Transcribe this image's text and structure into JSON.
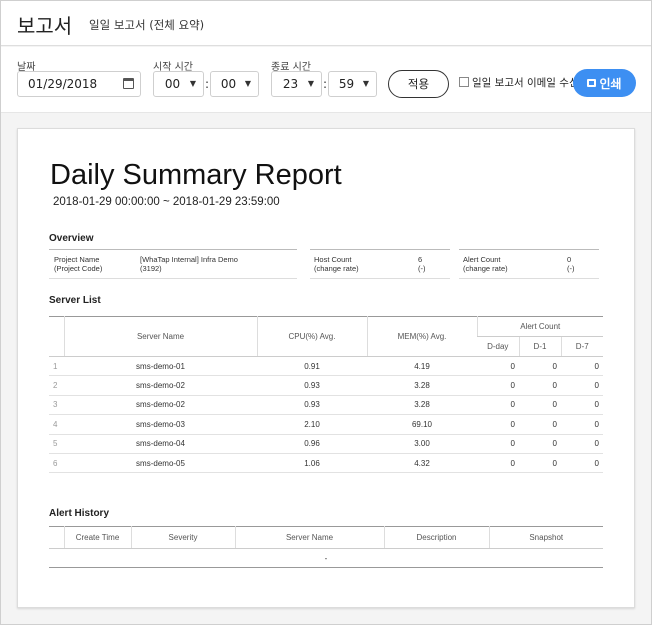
{
  "header": {
    "title": "보고서",
    "subtitle": "일일 보고서 (전체 요약)"
  },
  "filters": {
    "date_label": "날짜",
    "date_value": "01/29/2018",
    "start_label": "시작 시간",
    "start_hour": "00",
    "start_minute": "00",
    "end_label": "종료 시간",
    "end_hour": "23",
    "end_minute": "59",
    "colon": ":",
    "apply_label": "적용",
    "email_label": "일일 보고서 이메일 수신",
    "print_label": "인쇄"
  },
  "report": {
    "title": "Daily Summary Report",
    "range": "2018-01-29 00:00:00 ~ 2018-01-29 23:59:00",
    "overview": {
      "heading": "Overview",
      "project_label_1": "Project Name",
      "project_label_2": "(Project Code)",
      "project_value_1": "[WhaTap Internal] Infra Demo",
      "project_value_2": "(3192)",
      "host_label_1": "Host Count",
      "host_label_2": "(change rate)",
      "host_value_1": "6",
      "host_value_2": "(-)",
      "alert_label_1": "Alert Count",
      "alert_label_2": "(change rate)",
      "alert_value_1": "0",
      "alert_value_2": "(-)"
    },
    "server_list": {
      "heading": "Server List",
      "columns": {
        "name": "Server Name",
        "cpu": "CPU(%) Avg.",
        "mem": "MEM(%) Avg.",
        "alert": "Alert Count",
        "dday": "D-day",
        "d1": "D-1",
        "d7": "D-7"
      },
      "rows": [
        {
          "n": "1",
          "name": "sms-demo-01",
          "cpu": "0.91",
          "mem": "4.19",
          "dday": "0",
          "d1": "0",
          "d7": "0"
        },
        {
          "n": "2",
          "name": "sms-demo-02",
          "cpu": "0.93",
          "mem": "3.28",
          "dday": "0",
          "d1": "0",
          "d7": "0"
        },
        {
          "n": "3",
          "name": "sms-demo-02",
          "cpu": "0.93",
          "mem": "3.28",
          "dday": "0",
          "d1": "0",
          "d7": "0"
        },
        {
          "n": "4",
          "name": "sms-demo-03",
          "cpu": "2.10",
          "mem": "69.10",
          "dday": "0",
          "d1": "0",
          "d7": "0"
        },
        {
          "n": "5",
          "name": "sms-demo-04",
          "cpu": "0.96",
          "mem": "3.00",
          "dday": "0",
          "d1": "0",
          "d7": "0"
        },
        {
          "n": "6",
          "name": "sms-demo-05",
          "cpu": "1.06",
          "mem": "4.32",
          "dday": "0",
          "d1": "0",
          "d7": "0"
        }
      ]
    },
    "alert_history": {
      "heading": "Alert History",
      "columns": {
        "time": "Create Time",
        "severity": "Severity",
        "server": "Server Name",
        "desc": "Description",
        "snap": "Snapshot"
      },
      "empty": "-"
    }
  }
}
